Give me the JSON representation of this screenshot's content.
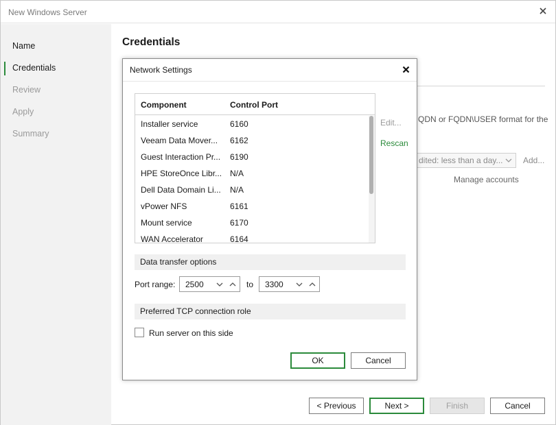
{
  "window": {
    "title": "New Windows Server"
  },
  "sidebar": {
    "items": [
      {
        "label": "Name",
        "state": "done"
      },
      {
        "label": "Credentials",
        "state": "current"
      },
      {
        "label": "Review",
        "state": "disabled"
      },
      {
        "label": "Apply",
        "state": "disabled"
      },
      {
        "label": "Summary",
        "state": "disabled"
      }
    ]
  },
  "page": {
    "title": "Credentials",
    "hint_fragment": "QDN or FQDN\\USER format for the",
    "account_select_value": "dited: less than a day...",
    "add_label": "Add...",
    "manage_accounts_label": "Manage accounts"
  },
  "footer": {
    "previous_label": "< Previous",
    "next_label": "Next >",
    "finish_label": "Finish",
    "cancel_label": "Cancel"
  },
  "modal": {
    "title": "Network Settings",
    "table": {
      "col_component": "Component",
      "col_port": "Control Port",
      "rows": [
        {
          "component": "Installer service",
          "port": "6160"
        },
        {
          "component": "Veeam Data Mover...",
          "port": "6162"
        },
        {
          "component": "Guest Interaction Pr...",
          "port": "6190"
        },
        {
          "component": "HPE StoreOnce Libr...",
          "port": "N/A"
        },
        {
          "component": "Dell Data Domain Li...",
          "port": "N/A"
        },
        {
          "component": "vPower NFS",
          "port": "6161"
        },
        {
          "component": "Mount service",
          "port": "6170"
        },
        {
          "component": "WAN Accelerator",
          "port": "6164"
        }
      ]
    },
    "edit_label": "Edit...",
    "rescan_label": "Rescan",
    "data_transfer_section": "Data transfer options",
    "port_range_label": "Port range:",
    "port_from": "2500",
    "to_label": "to",
    "port_to": "3300",
    "tcp_section": "Preferred TCP connection role",
    "run_server_label": "Run server on this side",
    "run_server_checked": false,
    "ok_label": "OK",
    "cancel_label": "Cancel"
  },
  "colors": {
    "accent": "#2a8a3a",
    "sidebar_bg": "#f2f2f2",
    "section_bg": "#f0f0f0"
  }
}
